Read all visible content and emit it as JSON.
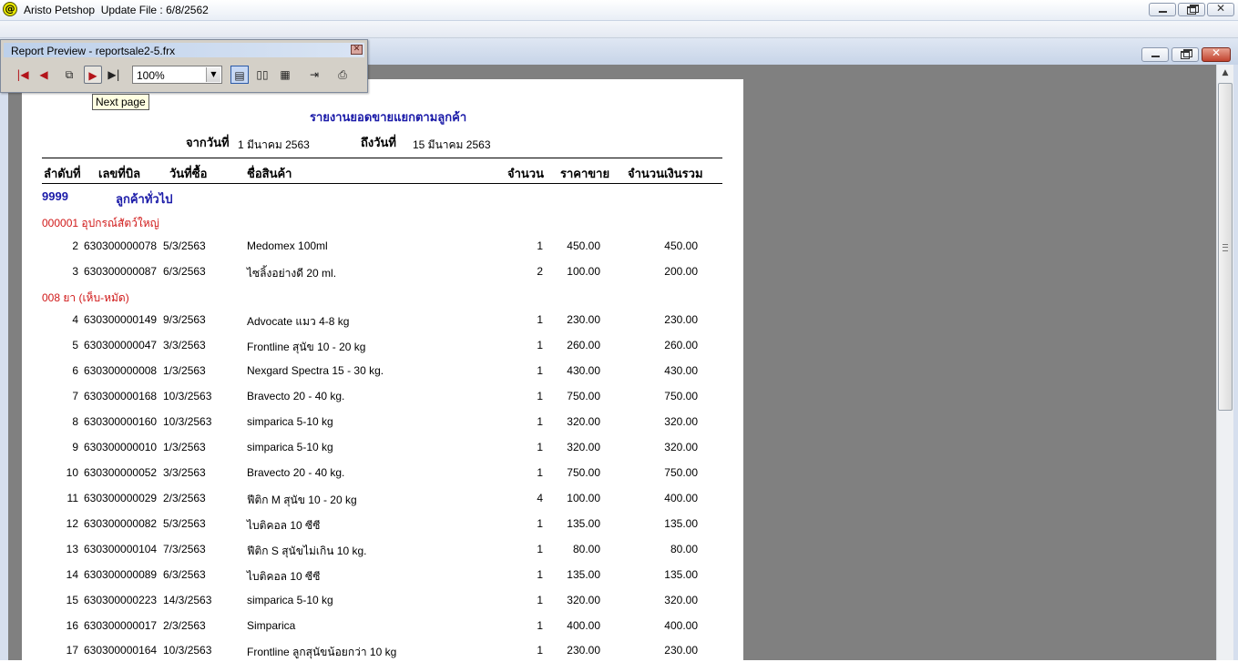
{
  "app": {
    "title": "Aristo Petshop  Update File : 6/8/2562",
    "icon": "at-icon",
    "icon_glyph": "@"
  },
  "toolbar_window": {
    "title": "Report Preview - reportsale2-5.frx",
    "zoom": "100%",
    "buttons": [
      "first-page-icon",
      "previous-page-icon",
      "go-to-page-icon",
      "next-page-icon",
      "last-page-icon",
      "one-page-view-icon",
      "two-page-view-icon",
      "multi-page-view-icon",
      "close-preview-icon",
      "print-icon"
    ],
    "tooltip": "Next page"
  },
  "report": {
    "title": "รายงานยอดขายแยกตามลูกค้า",
    "from_label": "จากวันที่",
    "from_value": "1 มีนาคม 2563",
    "to_label": "ถึงวันที่",
    "to_value": "15 มีนาคม 2563",
    "columns": [
      "ลำดับที่",
      "เลขที่บิล",
      "วันที่ซื้อ",
      "ชื่อสินค้า",
      "จำนวน",
      "ราคาขาย",
      "จำนวนเงินรวม"
    ],
    "customer_code": "9999",
    "customer_name": "ลูกค้าทั่วไป",
    "groups": [
      {
        "name": "000001 อุปกรณ์สัตว์ใหญ่",
        "rows": [
          {
            "no": "2",
            "bill": "630300000078",
            "date": "5/3/2563",
            "item": "Medomex 100ml",
            "qty": "1",
            "price": "450.00",
            "total": "450.00"
          },
          {
            "no": "3",
            "bill": "630300000087",
            "date": "6/3/2563",
            "item": "ไซลิ้งอย่างดี 20 ml.",
            "qty": "2",
            "price": "100.00",
            "total": "200.00"
          }
        ]
      },
      {
        "name": "008 ยา (เห็บ-หมัด)",
        "rows": [
          {
            "no": "4",
            "bill": "630300000149",
            "date": "9/3/2563",
            "item": "Advocate แมว 4-8 kg",
            "qty": "1",
            "price": "230.00",
            "total": "230.00"
          },
          {
            "no": "5",
            "bill": "630300000047",
            "date": "3/3/2563",
            "item": "Frontline สุนัข 10 - 20 kg",
            "qty": "1",
            "price": "260.00",
            "total": "260.00"
          },
          {
            "no": "6",
            "bill": "630300000008",
            "date": "1/3/2563",
            "item": "Nexgard Spectra 15 - 30 kg.",
            "qty": "1",
            "price": "430.00",
            "total": "430.00"
          },
          {
            "no": "7",
            "bill": "630300000168",
            "date": "10/3/2563",
            "item": "Bravecto 20 - 40 kg.",
            "qty": "1",
            "price": "750.00",
            "total": "750.00"
          },
          {
            "no": "8",
            "bill": "630300000160",
            "date": "10/3/2563",
            "item": "simparica 5-10 kg",
            "qty": "1",
            "price": "320.00",
            "total": "320.00"
          },
          {
            "no": "9",
            "bill": "630300000010",
            "date": "1/3/2563",
            "item": "simparica 5-10 kg",
            "qty": "1",
            "price": "320.00",
            "total": "320.00"
          },
          {
            "no": "10",
            "bill": "630300000052",
            "date": "3/3/2563",
            "item": "Bravecto 20 - 40 kg.",
            "qty": "1",
            "price": "750.00",
            "total": "750.00"
          },
          {
            "no": "11",
            "bill": "630300000029",
            "date": "2/3/2563",
            "item": "ฟีติก M  สุนัข 10 - 20 kg",
            "qty": "4",
            "price": "100.00",
            "total": "400.00"
          },
          {
            "no": "12",
            "bill": "630300000082",
            "date": "5/3/2563",
            "item": "ไบติคอล 10 ซีซี",
            "qty": "1",
            "price": "135.00",
            "total": "135.00"
          },
          {
            "no": "13",
            "bill": "630300000104",
            "date": "7/3/2563",
            "item": "ฟีติก S สุนัขไม่เกิน 10 kg.",
            "qty": "1",
            "price": "80.00",
            "total": "80.00"
          },
          {
            "no": "14",
            "bill": "630300000089",
            "date": "6/3/2563",
            "item": "ไบติคอล 10 ซีซี",
            "qty": "1",
            "price": "135.00",
            "total": "135.00"
          },
          {
            "no": "15",
            "bill": "630300000223",
            "date": "14/3/2563",
            "item": "simparica 5-10 kg",
            "qty": "1",
            "price": "320.00",
            "total": "320.00"
          },
          {
            "no": "16",
            "bill": "630300000017",
            "date": "2/3/2563",
            "item": "Simparica",
            "qty": "1",
            "price": "400.00",
            "total": "400.00"
          },
          {
            "no": "17",
            "bill": "630300000164",
            "date": "10/3/2563",
            "item": "Frontline ลูกสุนัขน้อยกว่า 10 kg",
            "qty": "1",
            "price": "230.00",
            "total": "230.00"
          }
        ]
      }
    ]
  },
  "colors": {
    "canvas": "#808080",
    "group_header": "#d01818",
    "report_title": "#1a1aa8"
  }
}
